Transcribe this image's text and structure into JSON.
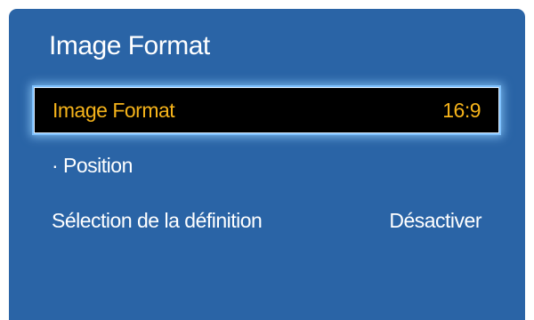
{
  "panel": {
    "title": "Image Format",
    "items": [
      {
        "label": "Image Format",
        "value": "16:9",
        "selected": true
      },
      {
        "label": "· Position",
        "value": "",
        "selected": false
      },
      {
        "label": "Sélection de la définition",
        "value": "Désactiver",
        "selected": false
      }
    ]
  },
  "colors": {
    "panel_background": "#2a64a6",
    "selected_background": "#000000",
    "selected_text": "#f5b31a",
    "focus_glow": "#7fc2ff",
    "text": "#ffffff"
  }
}
